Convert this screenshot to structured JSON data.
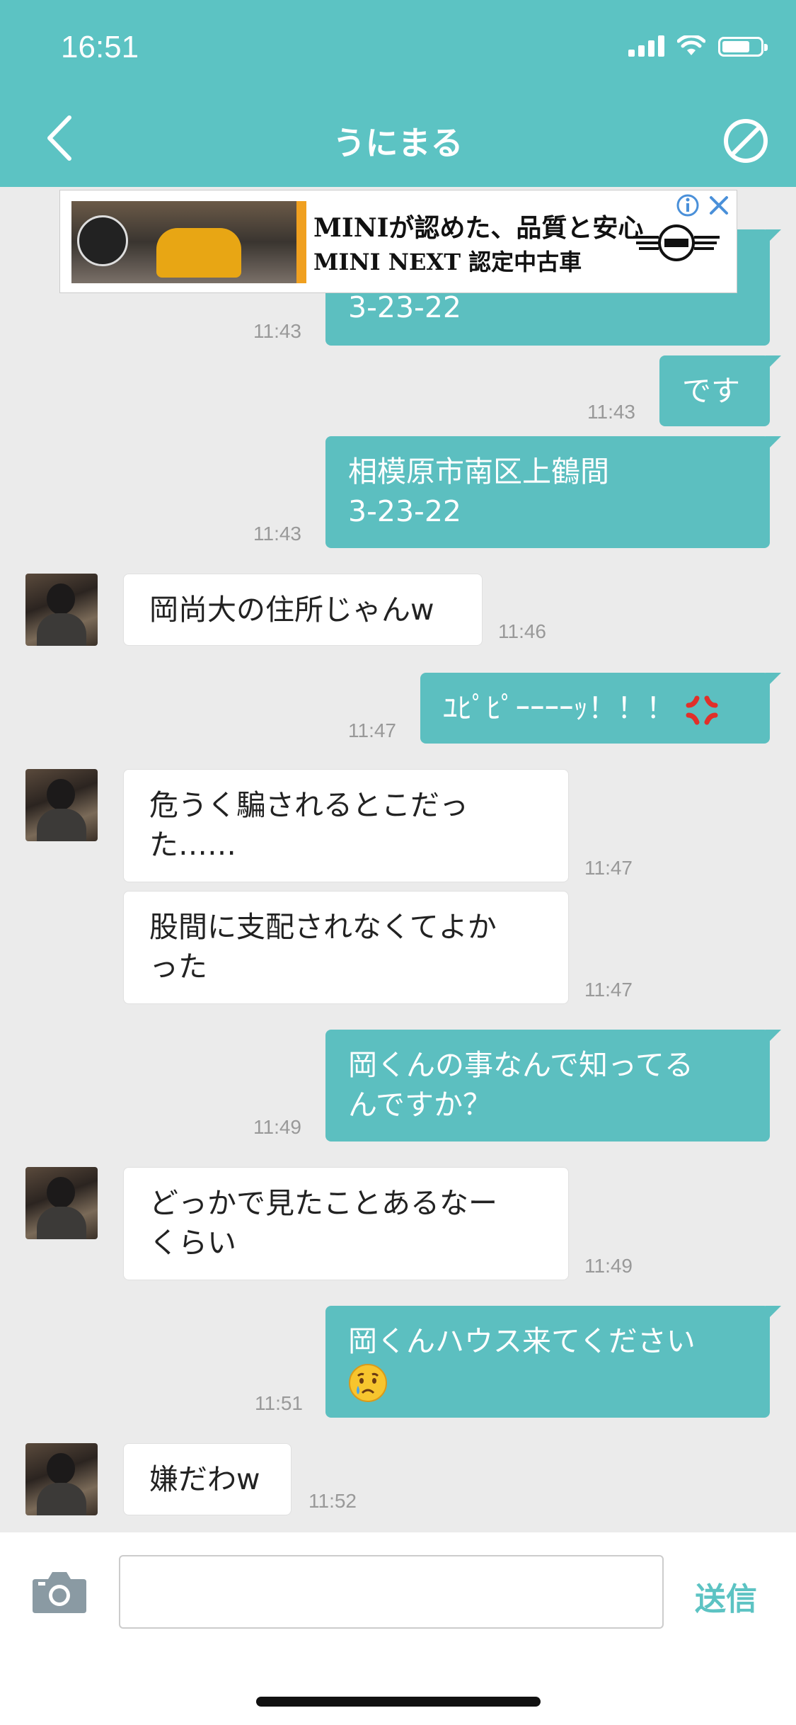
{
  "status_bar": {
    "time": "16:51"
  },
  "header": {
    "title": "うにまる"
  },
  "ad": {
    "line1": "MINIが認めた、品質と安心",
    "line2": "MINI NEXT 認定中古車"
  },
  "messages": [
    {
      "text": "3-23-22",
      "time": "11:43"
    },
    {
      "text": "です",
      "time": "11:43"
    },
    {
      "text": "相模原市南区上鶴間",
      "text2": "3-23-22",
      "time": "11:43"
    },
    {
      "text": "岡尚大の住所じゃんw",
      "time": "11:46"
    },
    {
      "text": "ﾕﾋﾟﾋﾟｰｰｰｰｯ！！！",
      "time": "11:47"
    },
    {
      "text": "危うく騙されるとこだっ",
      "text2": "た……",
      "time": "11:47"
    },
    {
      "text": "股間に支配されなくてよか",
      "text2": "った",
      "time": "11:47"
    },
    {
      "text": "岡くんの事なんで知ってる",
      "text2": "んですか？",
      "time": "11:49"
    },
    {
      "text": "どっかで見たことあるなー",
      "text2": "くらい",
      "time": "11:49"
    },
    {
      "text": "岡くんハウス来てください",
      "time": "11:51"
    },
    {
      "text": "嫌だわw",
      "time": "11:52"
    }
  ],
  "input": {
    "placeholder": "",
    "send_label": "送信"
  },
  "icons": {
    "back": "chevron-left-icon",
    "block": "block-icon",
    "camera": "camera-icon"
  },
  "colors": {
    "accent": "#5cc3c3",
    "background": "#ebebeb"
  }
}
